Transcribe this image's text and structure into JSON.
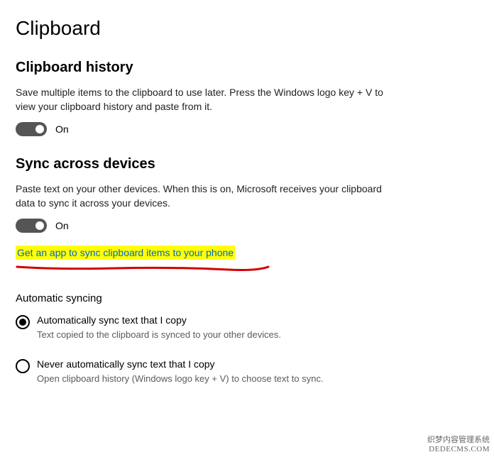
{
  "page": {
    "title": "Clipboard"
  },
  "history": {
    "heading": "Clipboard history",
    "description": "Save multiple items to the clipboard to use later. Press the Windows logo key + V to view your clipboard history and paste from it.",
    "toggle_state": "On"
  },
  "sync": {
    "heading": "Sync across devices",
    "description": "Paste text on your other devices. When this is on, Microsoft receives your clipboard data to sync it across your devices.",
    "toggle_state": "On",
    "app_link": "Get an app to sync clipboard items to your phone",
    "auto_heading": "Automatic syncing",
    "options": [
      {
        "label": "Automatically sync text that I copy",
        "description": "Text copied to the clipboard is synced to your other devices.",
        "selected": true
      },
      {
        "label": "Never automatically sync text that I copy",
        "description": "Open clipboard history (Windows logo key + V) to choose text to sync.",
        "selected": false
      }
    ]
  },
  "watermark": {
    "line1": "织梦内容管理系统",
    "line2": "DEDECMS.COM"
  }
}
